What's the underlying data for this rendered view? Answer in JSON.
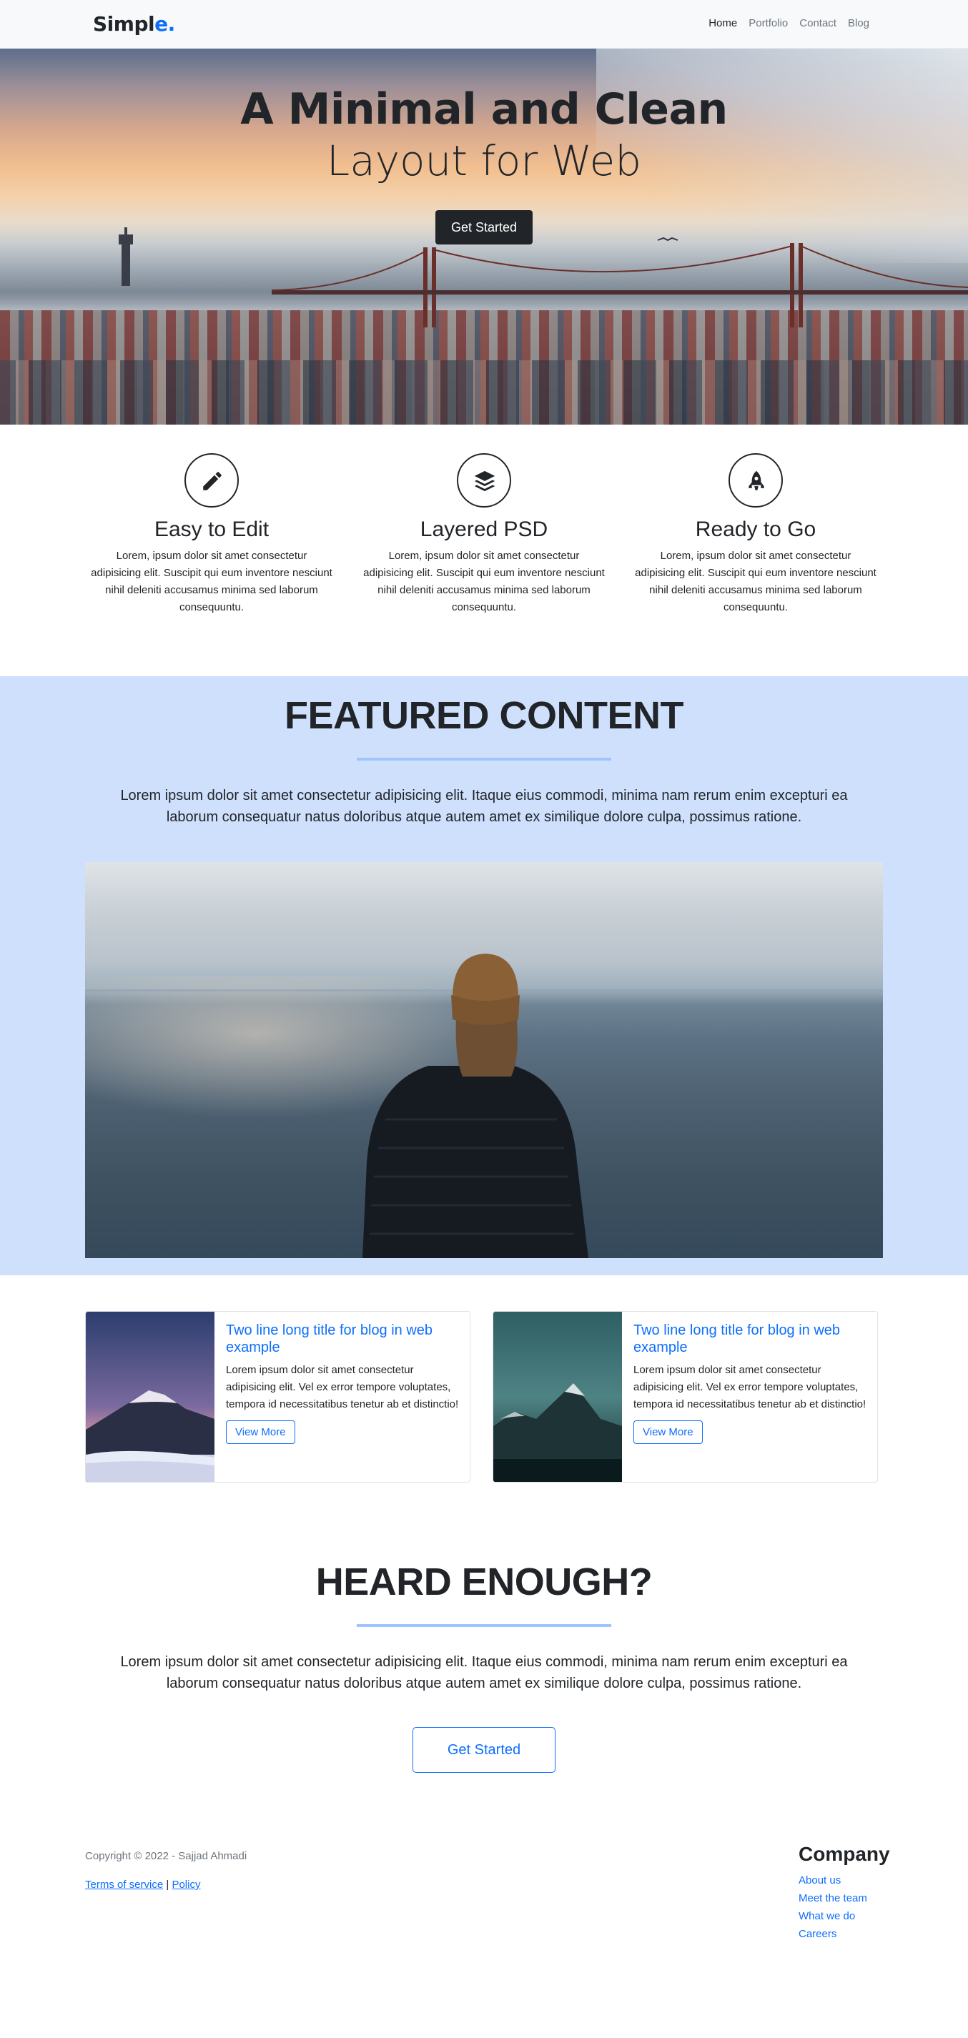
{
  "navbar": {
    "brand_text": "Simpl",
    "brand_accent": "e.",
    "links": [
      "Home",
      "Portfolio",
      "Contact",
      "Blog"
    ]
  },
  "hero": {
    "title_line1": "A Minimal and Clean",
    "title_line2": "Layout for Web",
    "button_label": "Get Started"
  },
  "features": [
    {
      "icon": "pencil-icon",
      "title": "Easy to Edit",
      "text": "Lorem, ipsum dolor sit amet consectetur adipisicing elit. Suscipit qui eum inventore nesciunt nihil deleniti accusamus minima sed laborum consequuntu."
    },
    {
      "icon": "layers-icon",
      "title": "Layered PSD",
      "text": "Lorem, ipsum dolor sit amet consectetur adipisicing elit. Suscipit qui eum inventore nesciunt nihil deleniti accusamus minima sed laborum consequuntu."
    },
    {
      "icon": "rocket-icon",
      "title": "Ready to Go",
      "text": "Lorem, ipsum dolor sit amet consectetur adipisicing elit. Suscipit qui eum inventore nesciunt nihil deleniti accusamus minima sed laborum consequuntu."
    }
  ],
  "featured": {
    "heading": "FEATURED CONTENT",
    "description": "Lorem ipsum dolor sit amet consectetur adipisicing elit. Itaque eius commodi, minima nam rerum enim excepturi ea laborum consequatur natus doloribus atque autem amet ex similique dolore culpa, possimus ratione."
  },
  "blog_cards": [
    {
      "title": "Two line long title for blog in web example",
      "text": "Lorem ipsum dolor sit amet consectetur adipisicing elit. Vel ex error tempore voluptates, tempora id necessitatibus tenetur ab et distinctio!",
      "button_label": "View More"
    },
    {
      "title": "Two line long title for blog in web example",
      "text": "Lorem ipsum dolor sit amet consectetur adipisicing elit. Vel ex error tempore voluptates, tempora id necessitatibus tenetur ab et distinctio!",
      "button_label": "View More"
    }
  ],
  "cta": {
    "heading": "HEARD ENOUGH?",
    "description": "Lorem ipsum dolor sit amet consectetur adipisicing elit. Itaque eius commodi, minima nam rerum enim excepturi ea laborum consequatur natus doloribus atque autem amet ex similique dolore culpa, possimus ratione.",
    "button_label": "Get Started"
  },
  "footer": {
    "copyright": "Copyright © 2022 - Sajjad Ahmadi",
    "terms_label": "Terms of service",
    "separator": "|",
    "policy_label": "Policy",
    "company_heading": "Company",
    "company_links": [
      "About us",
      "Meet the team",
      "What we do",
      "Careers"
    ]
  },
  "colors": {
    "accent": "#0d6efd",
    "featured_bg": "#cfe0fd",
    "dark": "#212529"
  }
}
